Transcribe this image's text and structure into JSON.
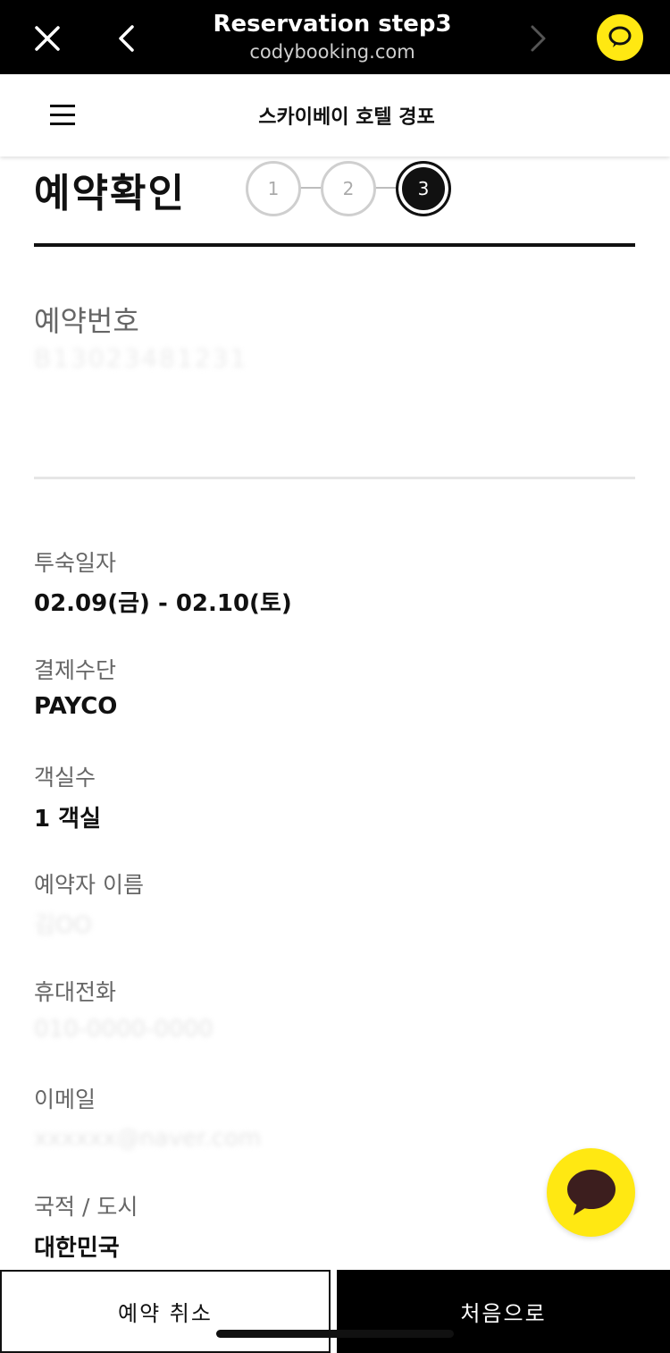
{
  "browser": {
    "title": "Reservation step3",
    "url": "codybooking.com",
    "icons": [
      "close-icon",
      "back-icon",
      "forward-icon",
      "kakao-chat-icon"
    ]
  },
  "header": {
    "hotel_name": "스카이베이 호텔 경포",
    "menu_icon": "hamburger-icon"
  },
  "page": {
    "title": "예약확인",
    "steps": [
      "1",
      "2",
      "3"
    ],
    "active_step": 3
  },
  "reservation": {
    "number_label": "예약번호",
    "number_value": "B13023481231"
  },
  "details": {
    "stay_label": "투숙일자",
    "stay_value": "02.09(금) - 02.10(토)",
    "payment_label": "결제수단",
    "payment_value": "PAYCO",
    "rooms_label": "객실수",
    "rooms_value": "1 객실",
    "name_label": "예약자 이름",
    "name_value": "김OO",
    "phone_label": "휴대전화",
    "phone_value": "010-0000-0000",
    "email_label": "이메일",
    "email_value": "xxxxxx@naver.com",
    "nation_label": "국적 / 도시",
    "nation_value": "대한민국"
  },
  "buttons": {
    "cancel": "예약 취소",
    "home": "처음으로"
  },
  "colors": {
    "kakao_yellow": "#FFE812",
    "black": "#000000"
  }
}
